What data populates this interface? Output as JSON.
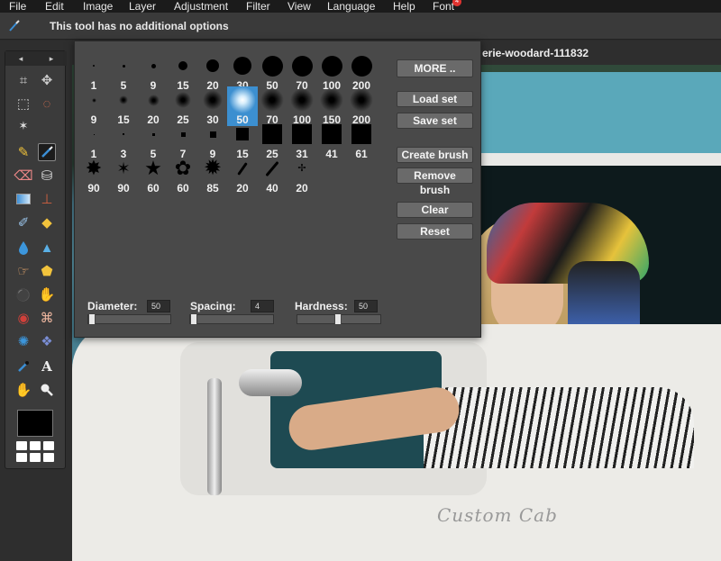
{
  "menu": {
    "items": [
      "File",
      "Edit",
      "Image",
      "Layer",
      "Adjustment",
      "Filter",
      "View",
      "Language",
      "Help",
      "Font"
    ],
    "font_badge": "4"
  },
  "options_bar": {
    "message": "This tool has no additional options"
  },
  "document": {
    "tab_title": "erie-woodard-111832"
  },
  "toolbox": {
    "nav_prev": "◂",
    "nav_next": "▸",
    "tools": [
      {
        "icon": "crop-icon",
        "glyph": "⌗"
      },
      {
        "icon": "move-icon",
        "glyph": "✥"
      },
      {
        "icon": "rect-select-icon",
        "glyph": "⬚"
      },
      {
        "icon": "lasso-icon",
        "glyph": "◌"
      },
      {
        "icon": "magic-wand-icon",
        "glyph": "✶"
      },
      {
        "icon": "pencil-icon",
        "glyph": "✎"
      },
      {
        "icon": "brush-icon",
        "glyph": "🖌"
      },
      {
        "icon": "eraser-icon",
        "glyph": "⌫"
      },
      {
        "icon": "paint-bucket-icon",
        "glyph": "⛁"
      },
      {
        "icon": "gradient-icon",
        "glyph": "▭"
      },
      {
        "icon": "stamp-icon",
        "glyph": "⊥"
      },
      {
        "icon": "color-replace-icon",
        "glyph": "✐"
      },
      {
        "icon": "shapes-icon",
        "glyph": "◆"
      },
      {
        "icon": "drop-icon",
        "glyph": "💧"
      },
      {
        "icon": "sharpen-icon",
        "glyph": "▲"
      },
      {
        "icon": "smudge-icon",
        "glyph": "☞"
      },
      {
        "icon": "sponge-icon",
        "glyph": "⬟"
      },
      {
        "icon": "dodge-icon",
        "glyph": "⚫"
      },
      {
        "icon": "burn-icon",
        "glyph": "✋"
      },
      {
        "icon": "red-eye-icon",
        "glyph": "◉"
      },
      {
        "icon": "bandage-icon",
        "glyph": "⌘"
      },
      {
        "icon": "bloat-icon",
        "glyph": "✺"
      },
      {
        "icon": "pinch-icon",
        "glyph": "❖"
      },
      {
        "icon": "eyedropper-icon",
        "glyph": "⚲"
      },
      {
        "icon": "text-icon",
        "glyph": "A"
      },
      {
        "icon": "hand-icon",
        "glyph": "✋"
      },
      {
        "icon": "zoom-icon",
        "glyph": "⚲"
      }
    ]
  },
  "brush_panel": {
    "rows": [
      {
        "kind": "hard",
        "labels": [
          "1",
          "5",
          "9",
          "15",
          "20",
          "30",
          "50",
          "70",
          "100",
          "200"
        ]
      },
      {
        "kind": "soft",
        "labels": [
          "9",
          "15",
          "20",
          "25",
          "30",
          "50",
          "70",
          "100",
          "150",
          "200"
        ]
      },
      {
        "kind": "square",
        "labels": [
          "1",
          "3",
          "5",
          "7",
          "9",
          "15",
          "25",
          "31",
          "41",
          "61"
        ]
      },
      {
        "kind": "custom",
        "labels": [
          "90",
          "90",
          "60",
          "60",
          "85",
          "20",
          "40",
          "20"
        ]
      }
    ],
    "selected_label": "50",
    "buttons": {
      "more": "MORE ..",
      "load_set": "Load set",
      "save_set": "Save set",
      "create_brush": "Create brush",
      "remove_brush": "Remove brush",
      "clear": "Clear",
      "reset": "Reset"
    },
    "diameter": {
      "label": "Diameter:",
      "value": "50",
      "fraction": 0.0
    },
    "spacing": {
      "label": "Spacing:",
      "value": "4",
      "fraction": 0.0
    },
    "hardness": {
      "label": "Hardness:",
      "value": "50",
      "fraction": 0.5
    }
  },
  "photo": {
    "logo_text": "Custom Cab"
  }
}
